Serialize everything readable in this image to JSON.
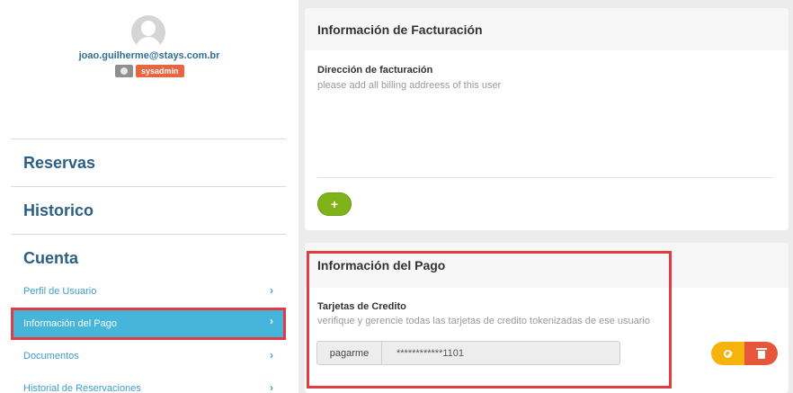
{
  "user": {
    "email": "joao.guilherme@stays.com.br",
    "role_badge": "sysadmin"
  },
  "sidebar": {
    "sections": [
      "Reservas",
      "Historico",
      "Cuenta"
    ],
    "items": [
      {
        "label": "Perfil de Usuario",
        "active": false
      },
      {
        "label": "Información del Pago",
        "active": true
      },
      {
        "label": "Documentos",
        "active": false
      },
      {
        "label": "Historial de Reservaciones",
        "active": false
      }
    ],
    "chevron": "›"
  },
  "billing": {
    "title": "Información de Facturación",
    "field_label": "Dirección de facturación",
    "field_help": "please add all billing addreess of this user",
    "add_label": "+"
  },
  "payment": {
    "title": "Información del Pago",
    "field_label": "Tarjetas de Credito",
    "field_help": "verifique y gerencie todas las tarjetas de credito tokenizadas de ese usuario",
    "card": {
      "brand": "pagarme",
      "number": "************1101"
    }
  },
  "colors": {
    "accent_blue": "#45b5db",
    "nav_heading": "#2c5f84",
    "highlight_red": "#e03c41",
    "add_green": "#7fb319",
    "warn_yellow": "#f5b30c",
    "danger_red": "#e7553b"
  },
  "icons": [
    "user-avatar-icon",
    "globe-icon",
    "chevron-right-icon",
    "plus-icon",
    "ban-icon",
    "trash-icon"
  ]
}
